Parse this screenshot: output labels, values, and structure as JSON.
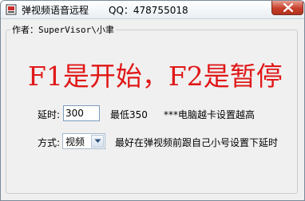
{
  "window": {
    "title": "弹视频语音远程",
    "qq": "QQ：478755018"
  },
  "group": {
    "legend": "作者：SuperVisor\\小聿"
  },
  "headline": "F1是开始，F2是暂停",
  "delay": {
    "label": "延时:",
    "value": "300",
    "min_note": "最低350",
    "tip": "***电脑越卡设置越高"
  },
  "mode": {
    "label": "方式:",
    "selected": "视频",
    "tip": "最好在弹视频前跟自己小号设置下延时"
  },
  "colors": {
    "headline": "#e01818",
    "close_button": "#c7402b"
  },
  "icons": {
    "app": "app-icon",
    "close": "close-icon",
    "dropdown": "chevron-down-icon"
  }
}
